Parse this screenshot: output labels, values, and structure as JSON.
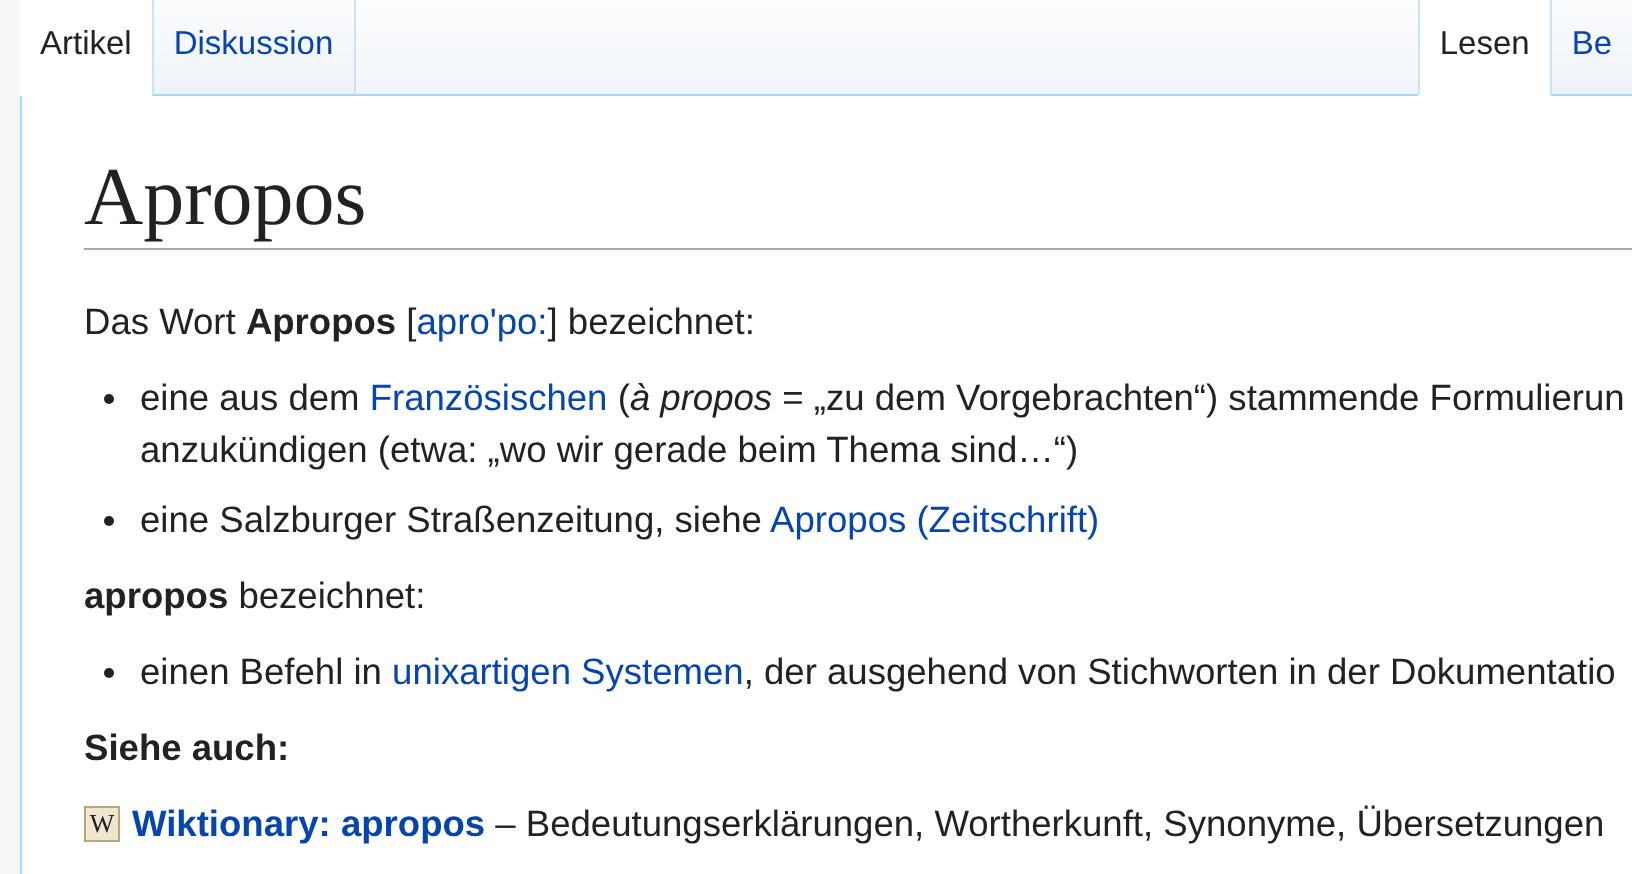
{
  "tabs_left": [
    {
      "label": "Artikel",
      "selected": true
    },
    {
      "label": "Diskussion",
      "selected": false
    }
  ],
  "tabs_right": [
    {
      "label": "Lesen",
      "selected": true
    },
    {
      "label": "Be",
      "selected": false
    }
  ],
  "title": "Apropos",
  "content": [
    {
      "kind": "paragraph",
      "segments": [
        {
          "kind": "text",
          "text": "Das Wort **Apropos** ["
        },
        {
          "kind": "link",
          "text": "apro'po:"
        },
        {
          "kind": "text",
          "text": "] bezeichnet:"
        }
      ]
    },
    {
      "kind": "list",
      "items": [
        {
          "segments": [
            {
              "kind": "text",
              "text": "eine aus dem "
            },
            {
              "kind": "link",
              "text": "Französischen"
            },
            {
              "kind": "text",
              "text": " (*à propos* = „zu dem Vorgebrachten“) stammende Formulierun"
            },
            {
              "kind": "break"
            },
            {
              "kind": "text",
              "text": "anzukündigen (etwa: „wo wir gerade beim Thema sind…“)"
            }
          ]
        },
        {
          "segments": [
            {
              "kind": "text",
              "text": "eine Salzburger Straßenzeitung, siehe "
            },
            {
              "kind": "link",
              "text": "Apropos (Zeitschrift)"
            }
          ]
        }
      ]
    },
    {
      "kind": "paragraph",
      "segments": [
        {
          "kind": "text",
          "text": "**apropos** bezeichnet:"
        }
      ]
    },
    {
      "kind": "list",
      "items": [
        {
          "segments": [
            {
              "kind": "text",
              "text": "einen Befehl in "
            },
            {
              "kind": "link",
              "text": "unixartigen Systemen"
            },
            {
              "kind": "text",
              "text": ", der ausgehend von Stichworten in der Dokumentatio"
            }
          ]
        }
      ]
    },
    {
      "kind": "heading",
      "segments": [
        {
          "kind": "text",
          "text": "Siehe auch:"
        }
      ]
    },
    {
      "kind": "sister",
      "icon": "W",
      "segments": [
        {
          "kind": "link",
          "bold": true,
          "text": "Wiktionary: apropos"
        },
        {
          "kind": "text",
          "text": " – Bedeutungserklärungen, Wortherkunft, Synonyme, Übersetzungen"
        }
      ]
    }
  ]
}
